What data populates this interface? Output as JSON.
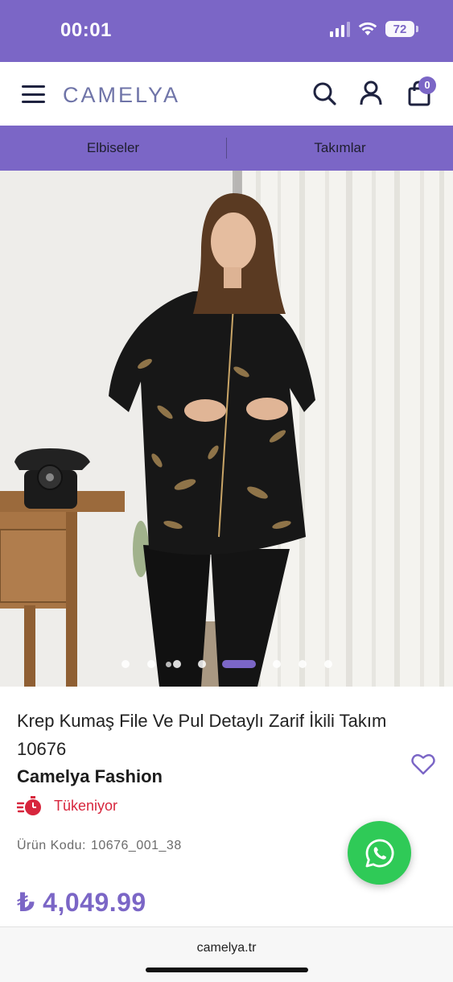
{
  "status_bar": {
    "time": "00:01",
    "battery": "72",
    "icons": [
      "signal-icon",
      "wifi-icon",
      "battery-icon"
    ]
  },
  "header": {
    "logo": "CAMELYA",
    "cart_count": "0",
    "icons": [
      "menu-icon",
      "search-icon",
      "user-icon",
      "shopping-bag-icon"
    ]
  },
  "categories": [
    {
      "label": "Elbiseler"
    },
    {
      "label": "Takımlar"
    }
  ],
  "carousel": {
    "total_slides": 9,
    "active_slide": 5
  },
  "product": {
    "title": "Krep Kumaş File Ve Pul Detaylı Zarif İkili Takım 10676",
    "brand": "Camelya Fashion",
    "stock_status": "Tükeniyor",
    "code_label": "Ürün Kodu:",
    "code_value": "10676_001_38",
    "price": "₺ 4,049.99"
  },
  "browser": {
    "url": "camelya.tr"
  },
  "colors": {
    "brand_purple": "#7b66c6",
    "stock_red": "#d7263d",
    "whatsapp_green": "#2fca57"
  }
}
